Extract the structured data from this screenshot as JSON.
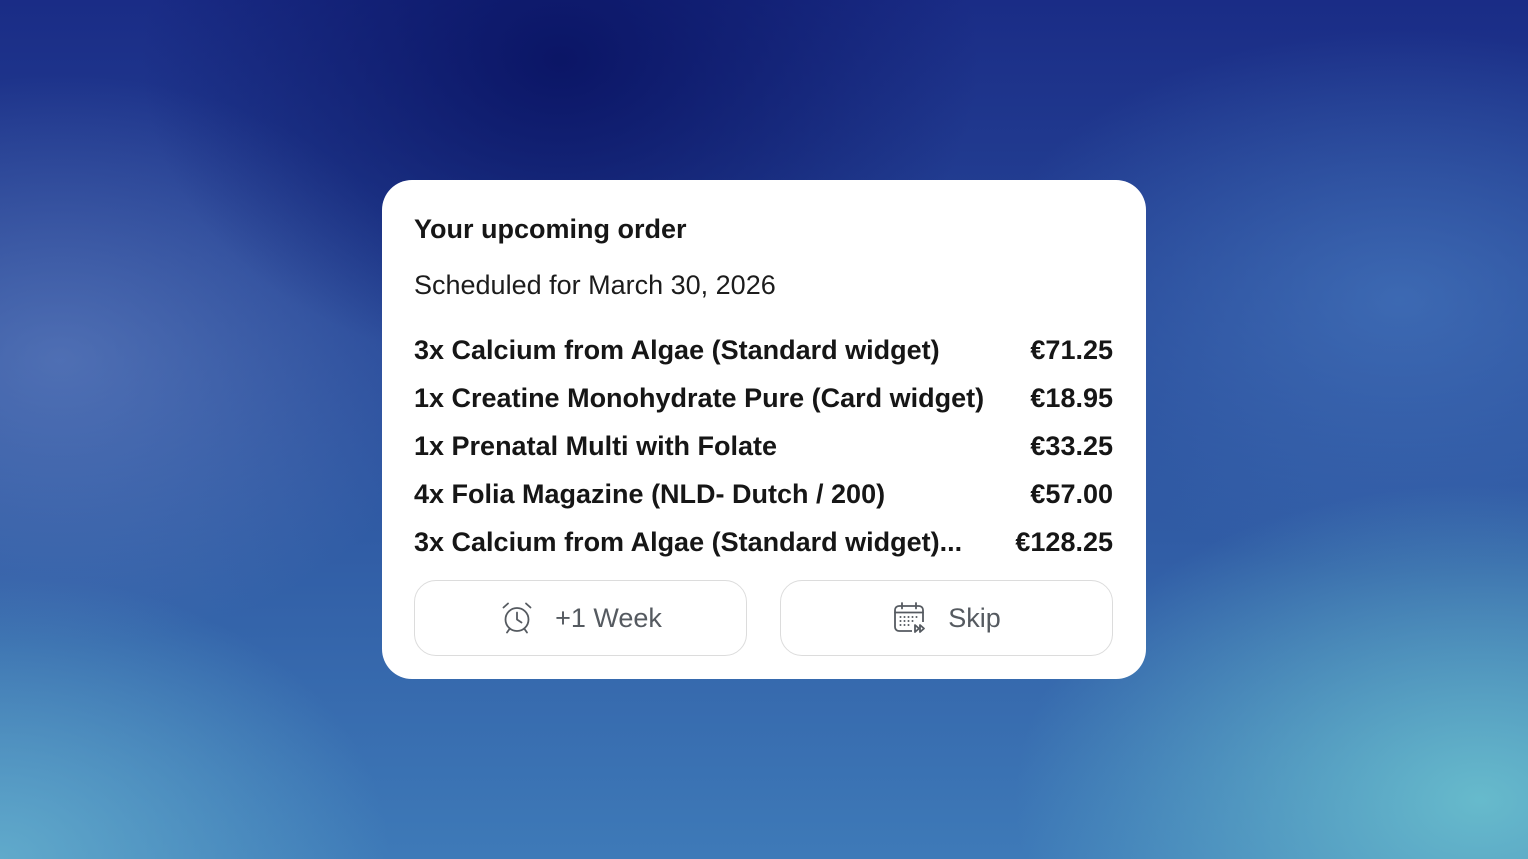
{
  "widget": {
    "title": "Your upcoming order",
    "scheduled": "Scheduled for March 30, 2026",
    "items": [
      {
        "name": "3x Calcium from Algae (Standard widget)",
        "price": "€71.25"
      },
      {
        "name": "1x Creatine Monohydrate Pure (Card widget)",
        "price": "€18.95"
      },
      {
        "name": "1x Prenatal Multi with Folate",
        "price": "€33.25"
      },
      {
        "name": "4x Folia Magazine (NLD- Dutch / 200)",
        "price": "€57.00"
      },
      {
        "name": "3x Calcium from Algae (Standard widget)...",
        "price": "€128.25"
      }
    ],
    "actions": {
      "postpone": {
        "label": "+1 Week",
        "icon": "alarm-clock-icon"
      },
      "skip": {
        "label": "Skip",
        "icon": "calendar-skip-icon"
      }
    }
  },
  "colors": {
    "card_background": "#ffffff",
    "text_primary": "#161616",
    "button_text": "#555a60",
    "button_border": "#dcdcdc"
  }
}
